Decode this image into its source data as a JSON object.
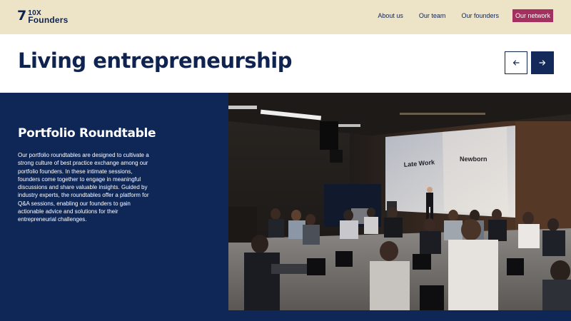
{
  "brand": {
    "mark": "7",
    "line1": "10X",
    "line2": "Founders"
  },
  "nav": [
    {
      "label": "About us",
      "active": false
    },
    {
      "label": "Our team",
      "active": false
    },
    {
      "label": "Our founders",
      "active": false
    },
    {
      "label": "Our network",
      "active": true
    }
  ],
  "hero": {
    "title": "Living entrepreneurship"
  },
  "carousel": {
    "prev_icon": "arrow-left-icon",
    "next_icon": "arrow-right-icon"
  },
  "card": {
    "title": "Portfolio Roundtable",
    "body": "Our portfolio roundtables are designed to cultivate a strong culture of best practice exchange among our portfolio founders. In these intimate sessions, founders come together to engage in meaningful discussions and share valuable insights. Guided by industry experts, the roundtables offer a platform for Q&A sessions, enabling our founders to gain actionable advice and solutions for their entrepreneurial challenges."
  },
  "photo": {
    "screen_left_text": "Late Work",
    "screen_right_text": "Newborn"
  },
  "colors": {
    "navy": "#0f2757",
    "cream": "#ede3c7",
    "accent": "#a4305f",
    "white": "#ffffff"
  }
}
